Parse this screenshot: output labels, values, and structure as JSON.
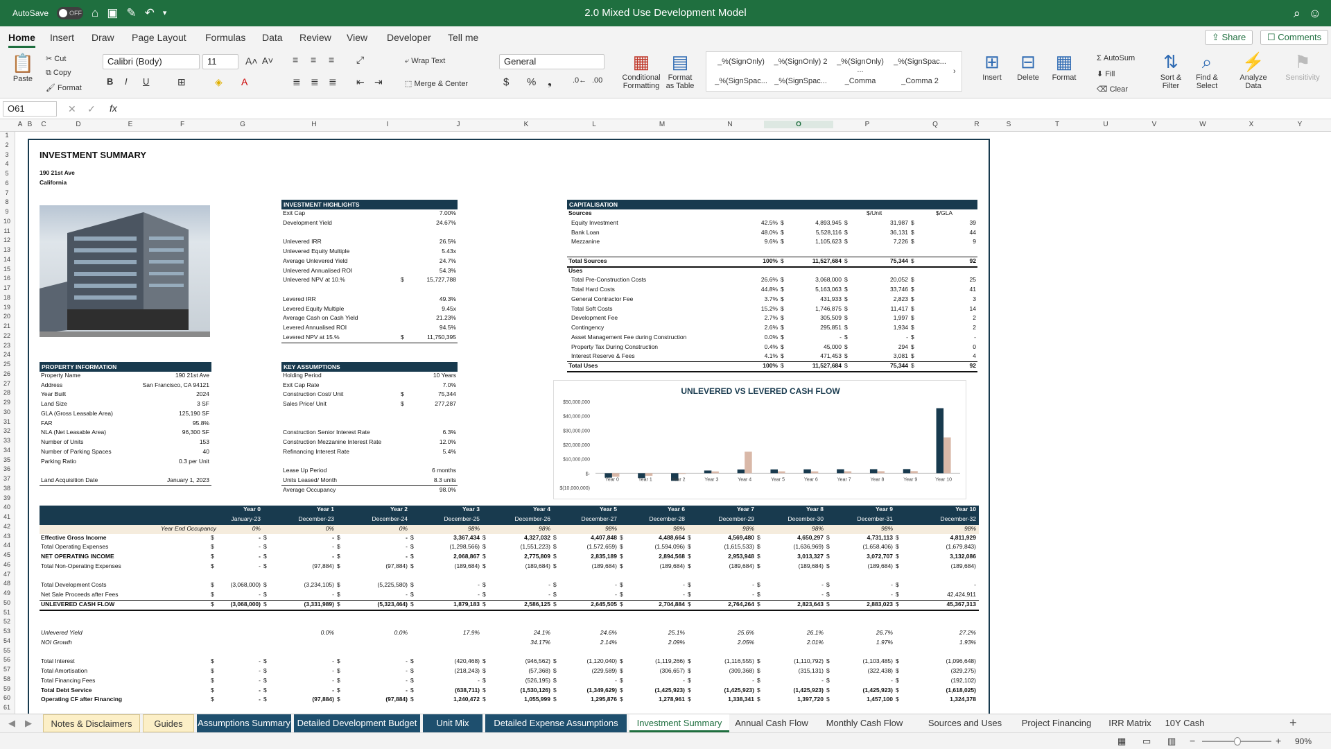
{
  "app": {
    "autosave": "AutoSave",
    "autosave_state": "OFF",
    "title": "2.0 Mixed Use Development Model"
  },
  "menu": [
    "Home",
    "Insert",
    "Draw",
    "Page Layout",
    "Formulas",
    "Data",
    "Review",
    "View",
    "Developer",
    "Tell me"
  ],
  "share": "Share",
  "comments": "Comments",
  "ribbon": {
    "paste": "Paste",
    "cut": "Cut",
    "copy": "Copy",
    "format": "Format",
    "font": "Calibri (Body)",
    "size": "11",
    "wrap": "Wrap Text",
    "merge": "Merge & Center",
    "numfmt": "General",
    "cond": "Conditional Formatting",
    "fmt_table": "Format as Table",
    "styles": [
      "_%(SignOnly)",
      "_%(SignOnly) 2",
      "_%(SignOnly) ...",
      "_%(SignSpac...",
      "_%(SignSpac...",
      "_%(SignSpac...",
      "_Comma",
      "_Comma 2"
    ],
    "insert": "Insert",
    "delete": "Delete",
    "format_btn": "Format",
    "autosum": "AutoSum",
    "fill": "Fill",
    "clear": "Clear",
    "sort": "Sort & Filter",
    "find": "Find & Select",
    "analyze": "Analyze Data",
    "sensitivity": "Sensitivity"
  },
  "namebox": "O61",
  "fx": "fx",
  "cols": [
    "A",
    "B",
    "C",
    "D",
    "E",
    "F",
    "G",
    "H",
    "I",
    "J",
    "K",
    "L",
    "M",
    "N",
    "O",
    "P",
    "Q",
    "R",
    "S",
    "T",
    "U",
    "V",
    "W",
    "X",
    "Y"
  ],
  "summary": {
    "title": "INVESTMENT SUMMARY",
    "address": "190 21st Ave",
    "state": "California"
  },
  "highlights": {
    "header": "INVESTMENT HIGHLIGHTS",
    "rows": [
      [
        "Exit Cap",
        "",
        "7.00%"
      ],
      [
        "Development Yield",
        "",
        "24.67%"
      ],
      [
        "",
        "",
        ""
      ],
      [
        "Unlevered IRR",
        "",
        "26.5%"
      ],
      [
        "Unlevered Equity Multiple",
        "",
        "5.43x"
      ],
      [
        "Average Unlevered Yield",
        "",
        "24.7%"
      ],
      [
        "Unlevered Annualised ROI",
        "",
        "54.3%"
      ],
      [
        "Unlevered NPV at  10.%",
        "$",
        "15,727,788"
      ],
      [
        "",
        "",
        ""
      ],
      [
        "Levered IRR",
        "",
        "49.3%"
      ],
      [
        "Levered Equity Multiple",
        "",
        "9.45x"
      ],
      [
        "Average Cash on Cash Yield",
        "",
        "21.23%"
      ],
      [
        "Levered Annualised ROI",
        "",
        "94.5%"
      ],
      [
        "Levered NPV at  15.%",
        "$",
        "11,750,395"
      ]
    ]
  },
  "property": {
    "header": "PROPERTY INFORMATION",
    "rows": [
      [
        "Property Name",
        "190 21st Ave"
      ],
      [
        "Address",
        "San Francisco, CA 94121"
      ],
      [
        "Year Built",
        "2024"
      ],
      [
        "Land Size",
        "3 SF"
      ],
      [
        "GLA (Gross Leasable Area)",
        "125,190 SF"
      ],
      [
        "FAR",
        "95.8%"
      ],
      [
        "NLA (Net Leasable Area)",
        "96,300 SF"
      ],
      [
        "Number of Units",
        "153"
      ],
      [
        "Number of Parking Spaces",
        "40"
      ],
      [
        "Parking Ratio",
        "0.3 per Unit"
      ],
      [
        "",
        ""
      ],
      [
        "Land Acquisition Date",
        "January 1, 2023"
      ]
    ]
  },
  "key": {
    "header": "KEY ASSUMPTIONS",
    "rows": [
      [
        "Holding Period",
        "",
        "10 Years"
      ],
      [
        "Exit Cap Rate",
        "",
        "7.0%"
      ],
      [
        "Construction Cost/ Unit",
        "$",
        "75,344"
      ],
      [
        "Sales Price/ Unit",
        "$",
        "277,287"
      ],
      [
        "",
        "",
        ""
      ],
      [
        "",
        "",
        ""
      ],
      [
        "Construction Senior Interest Rate",
        "",
        "6.3%"
      ],
      [
        "Construction Mezzanine Interest Rate",
        "",
        "12.0%"
      ],
      [
        "Refinancing Interest Rate",
        "",
        "5.4%"
      ],
      [
        "",
        "",
        ""
      ],
      [
        "Lease Up Period",
        "",
        "6 months"
      ],
      [
        "Units Leased/ Month",
        "",
        "8.3 units"
      ],
      [
        "Average Occupancy",
        "",
        "98.0%"
      ]
    ]
  },
  "cap": {
    "header": "CAPITALISATION",
    "unit_hdr": "$/Unit",
    "gla_hdr": "$/GLA",
    "sources": "Sources",
    "uses": "Uses",
    "rows": [
      [
        "Equity Investment",
        "42.5%",
        "4,893,945",
        "31,987",
        "39"
      ],
      [
        "Bank Loan",
        "48.0%",
        "5,528,116",
        "36,131",
        "44"
      ],
      [
        "Mezzanine",
        "9.6%",
        "1,105,623",
        "7,226",
        "9"
      ]
    ],
    "total_sources": [
      "Total Sources",
      "100%",
      "11,527,684",
      "75,344",
      "92"
    ],
    "use_rows": [
      [
        "Total Pre-Construction Costs",
        "26.6%",
        "3,068,000",
        "20,052",
        "25"
      ],
      [
        "Total Hard Costs",
        "44.8%",
        "5,163,063",
        "33,746",
        "41"
      ],
      [
        "General Contractor Fee",
        "3.7%",
        "431,933",
        "2,823",
        "3"
      ],
      [
        "Total Soft Costs",
        "15.2%",
        "1,746,875",
        "11,417",
        "14"
      ],
      [
        "Development Fee",
        "2.7%",
        "305,509",
        "1,997",
        "2"
      ],
      [
        "Contingency",
        "2.6%",
        "295,851",
        "1,934",
        "2"
      ],
      [
        "Asset Management Fee during Construction",
        "0.0%",
        "-",
        "-",
        "-"
      ],
      [
        "Property Tax During Construction",
        "0.4%",
        "45,000",
        "294",
        "0"
      ],
      [
        "Interest Reserve & Fees",
        "4.1%",
        "471,453",
        "3,081",
        "4"
      ]
    ],
    "total_uses": [
      "Total Uses",
      "100%",
      "11,527,684",
      "75,344",
      "92"
    ]
  },
  "chart_data": {
    "type": "bar",
    "title": "UNLEVERED VS LEVERED CASH FLOW",
    "categories": [
      "Year 0",
      "Year 1",
      "Year 2",
      "Year 3",
      "Year 4",
      "Year 5",
      "Year 6",
      "Year 7",
      "Year 8",
      "Year 9",
      "Year 10"
    ],
    "ylim": [
      -10000000,
      50000000
    ],
    "yticks": [
      "$50,000,000",
      "$40,000,000",
      "$30,000,000",
      "$20,000,000",
      "$10,000,000",
      "$-",
      "$(10,000,000)"
    ],
    "ytick_values": [
      50000000,
      40000000,
      30000000,
      20000000,
      10000000,
      0,
      -10000000
    ],
    "series": [
      {
        "values": [
          -3068000,
          -3331989,
          -5323464,
          1879183,
          2586125,
          2645505,
          2704884,
          2764264,
          2823643,
          2883023,
          45367313
        ],
        "color": "#183a4e"
      },
      {
        "values": [
          -2500000,
          -1800000,
          -100000,
          1240472,
          15000000,
          1295876,
          1278961,
          1338341,
          1397720,
          1457100,
          25000000
        ],
        "color": "#d9b8a8"
      }
    ]
  },
  "cf": {
    "years": [
      "Year 0",
      "Year 1",
      "Year 2",
      "Year 3",
      "Year 4",
      "Year 5",
      "Year 6",
      "Year 7",
      "Year 8",
      "Year 9",
      "Year 10"
    ],
    "dates": [
      "January-23",
      "December-23",
      "December-24",
      "December-25",
      "December-26",
      "December-27",
      "December-28",
      "December-29",
      "December-30",
      "December-31",
      "December-32"
    ],
    "occ_label": "Year End Occupancy",
    "occ": [
      "0%",
      "0%",
      "0%",
      "98%",
      "98%",
      "98%",
      "98%",
      "98%",
      "98%",
      "98%",
      "98%"
    ],
    "rows": [
      {
        "label": "Effective Gross Income",
        "bold": true,
        "v": [
          "-",
          "-",
          "-",
          "3,367,434",
          "4,327,032",
          "4,407,848",
          "4,488,664",
          "4,569,480",
          "4,650,297",
          "4,731,113",
          "4,811,929"
        ]
      },
      {
        "label": "Total Operating Expenses",
        "v": [
          "-",
          "-",
          "-",
          "(1,298,566)",
          "(1,551,223)",
          "(1,572,659)",
          "(1,594,096)",
          "(1,615,533)",
          "(1,636,969)",
          "(1,658,406)",
          "(1,679,843)"
        ]
      },
      {
        "label": "NET OPERATING INCOME",
        "bold": true,
        "v": [
          "-",
          "-",
          "-",
          "2,068,867",
          "2,775,809",
          "2,835,189",
          "2,894,568",
          "2,953,948",
          "3,013,327",
          "3,072,707",
          "3,132,086"
        ]
      },
      {
        "label": "Total Non-Operating Expenses",
        "v": [
          "-",
          "(97,884)",
          "(97,884)",
          "(189,684)",
          "(189,684)",
          "(189,684)",
          "(189,684)",
          "(189,684)",
          "(189,684)",
          "(189,684)",
          "(189,684)"
        ]
      },
      {
        "label": "",
        "v": []
      },
      {
        "label": "Total Development Costs",
        "v": [
          "(3,068,000)",
          "(3,234,105)",
          "(5,225,580)",
          "-",
          "-",
          "-",
          "-",
          "-",
          "-",
          "-",
          "-"
        ]
      },
      {
        "label": "Net Sale Proceeds after Fees",
        "v": [
          "-",
          "-",
          "-",
          "-",
          "-",
          "-",
          "-",
          "-",
          "-",
          "-",
          "42,424,911"
        ]
      },
      {
        "label": "UNLEVERED CASH FLOW",
        "bold": true,
        "v": [
          "(3,068,000)",
          "(3,331,989)",
          "(5,323,464)",
          "1,879,183",
          "2,586,125",
          "2,645,505",
          "2,704,884",
          "2,764,264",
          "2,823,643",
          "2,883,023",
          "45,367,313"
        ]
      }
    ],
    "yield_label": "Unlevered Yield",
    "yield": [
      "",
      "0.0%",
      "0.0%",
      "17.9%",
      "24.1%",
      "24.6%",
      "25.1%",
      "25.6%",
      "26.1%",
      "26.7%",
      "27.2%"
    ],
    "noi_label": "NOI Growth",
    "noi": [
      "",
      "",
      "",
      "",
      "34.17%",
      "2.14%",
      "2.09%",
      "2.05%",
      "2.01%",
      "1.97%",
      "1.93%"
    ],
    "fin": [
      {
        "label": "Total Interest",
        "v": [
          "-",
          "-",
          "-",
          "(420,468)",
          "(946,562)",
          "(1,120,040)",
          "(1,119,266)",
          "(1,116,555)",
          "(1,110,792)",
          "(1,103,485)",
          "(1,096,648)"
        ]
      },
      {
        "label": "Total Amortisation",
        "v": [
          "-",
          "-",
          "-",
          "(218,243)",
          "(57,368)",
          "(229,589)",
          "(306,657)",
          "(309,368)",
          "(315,131)",
          "(322,438)",
          "(329,275)"
        ]
      },
      {
        "label": "Total Financing Fees",
        "v": [
          "-",
          "-",
          "-",
          "-",
          "(526,195)",
          "-",
          "-",
          "-",
          "-",
          "-",
          "(192,102)"
        ]
      },
      {
        "label": "Total Debt Service",
        "bold": true,
        "v": [
          "-",
          "-",
          "-",
          "(638,711)",
          "(1,530,126)",
          "(1,349,629)",
          "(1,425,923)",
          "(1,425,923)",
          "(1,425,923)",
          "(1,425,923)",
          "(1,618,025)"
        ]
      },
      {
        "label": "Operating CF after Financing",
        "bold": true,
        "v": [
          "-",
          "(97,884)",
          "(97,884)",
          "1,240,472",
          "1,055,999",
          "1,295,876",
          "1,278,961",
          "1,338,341",
          "1,397,720",
          "1,457,100",
          "1,324,378"
        ]
      }
    ]
  },
  "tabs": [
    {
      "label": "Notes & Disclaimers",
      "style": "sand"
    },
    {
      "label": "Guides",
      "style": "sand"
    },
    {
      "label": "Assumptions Summary",
      "style": "navy"
    },
    {
      "label": "Detailed Development Budget",
      "style": "navy"
    },
    {
      "label": "Unit Mix",
      "style": "navy"
    },
    {
      "label": "Detailed Expense Assumptions",
      "style": "navy"
    },
    {
      "label": "Investment Summary",
      "style": "active"
    },
    {
      "label": "Annual Cash Flow",
      "style": "plain"
    },
    {
      "label": "Monthly Cash Flow",
      "style": "plain"
    },
    {
      "label": "Sources and Uses",
      "style": "plain"
    },
    {
      "label": "Project Financing",
      "style": "plain"
    },
    {
      "label": "IRR Matrix",
      "style": "plain"
    },
    {
      "label": "10Y Cash",
      "style": "plain"
    }
  ],
  "zoom": "90%"
}
